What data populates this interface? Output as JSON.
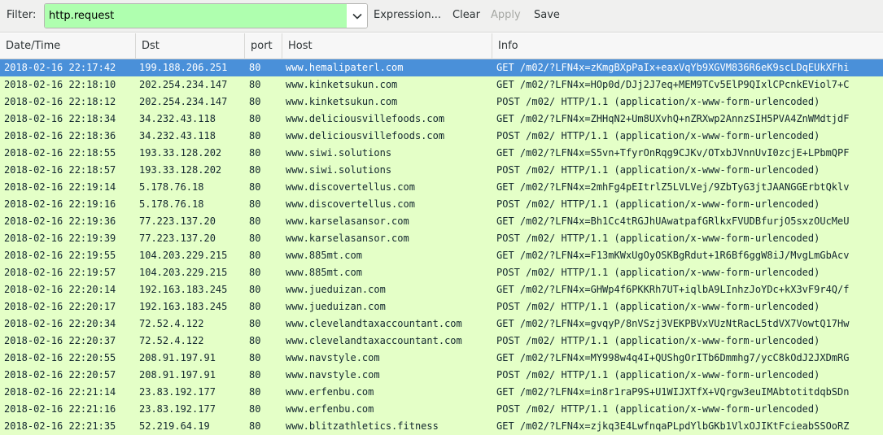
{
  "filter": {
    "label": "Filter:",
    "value": "http.request",
    "expression_label": "Expression...",
    "clear_label": "Clear",
    "apply_label": "Apply",
    "save_label": "Save"
  },
  "colors": {
    "filter_valid_bg": "#afffaf",
    "row_bg": "#e4ffc7",
    "selection": "#4a90d9"
  },
  "columns": [
    "Date/Time",
    "Dst",
    "port",
    "Host",
    "Info"
  ],
  "selected_row": 0,
  "rows": [
    {
      "time": "2018-02-16 22:17:42",
      "dst": "199.188.206.251",
      "port": "80",
      "host": "www.hemalipaterl.com",
      "info": "GET /m02/?LFN4x=zKmgBXpPaIx+eaxVqYb9XGVM836R6eK9scLDqEUkXFhi"
    },
    {
      "time": "2018-02-16 22:18:10",
      "dst": "202.254.234.147",
      "port": "80",
      "host": "www.kinketsukun.com",
      "info": "GET /m02/?LFN4x=HOp0d/DJj2J7eq+MEM9TCv5ElP9QIxlCPcnkEViol7+C"
    },
    {
      "time": "2018-02-16 22:18:12",
      "dst": "202.254.234.147",
      "port": "80",
      "host": "www.kinketsukun.com",
      "info": "POST /m02/ HTTP/1.1  (application/x-www-form-urlencoded)"
    },
    {
      "time": "2018-02-16 22:18:34",
      "dst": "34.232.43.118",
      "port": "80",
      "host": "www.deliciousvillefoods.com",
      "info": "GET /m02/?LFN4x=ZHHqN2+Um8UXvhQ+nZRXwp2AnnzSIH5PVA4ZnWMdtjdF"
    },
    {
      "time": "2018-02-16 22:18:36",
      "dst": "34.232.43.118",
      "port": "80",
      "host": "www.deliciousvillefoods.com",
      "info": "POST /m02/ HTTP/1.1  (application/x-www-form-urlencoded)"
    },
    {
      "time": "2018-02-16 22:18:55",
      "dst": "193.33.128.202",
      "port": "80",
      "host": "www.siwi.solutions",
      "info": "GET /m02/?LFN4x=S5vn+TfyrOnRqg9CJKv/OTxbJVnnUvI0zcjE+LPbmQPF"
    },
    {
      "time": "2018-02-16 22:18:57",
      "dst": "193.33.128.202",
      "port": "80",
      "host": "www.siwi.solutions",
      "info": "POST /m02/ HTTP/1.1  (application/x-www-form-urlencoded)"
    },
    {
      "time": "2018-02-16 22:19:14",
      "dst": "5.178.76.18",
      "port": "80",
      "host": "www.discovertellus.com",
      "info": "GET /m02/?LFN4x=2mhFg4pEItrlZ5LVLVej/9ZbTyG3jtJAANGGErbtQklv"
    },
    {
      "time": "2018-02-16 22:19:16",
      "dst": "5.178.76.18",
      "port": "80",
      "host": "www.discovertellus.com",
      "info": "POST /m02/ HTTP/1.1  (application/x-www-form-urlencoded)"
    },
    {
      "time": "2018-02-16 22:19:36",
      "dst": "77.223.137.20",
      "port": "80",
      "host": "www.karselasansor.com",
      "info": "GET /m02/?LFN4x=Bh1Cc4tRGJhUAwatpafGRlkxFVUDBfurjO5sxzOUcMeU"
    },
    {
      "time": "2018-02-16 22:19:39",
      "dst": "77.223.137.20",
      "port": "80",
      "host": "www.karselasansor.com",
      "info": "POST /m02/ HTTP/1.1  (application/x-www-form-urlencoded)"
    },
    {
      "time": "2018-02-16 22:19:55",
      "dst": "104.203.229.215",
      "port": "80",
      "host": "www.885mt.com",
      "info": "GET /m02/?LFN4x=F13mKWxUgOyOSKBgRdut+1R6Bf6ggW8iJ/MvgLmGbAcv"
    },
    {
      "time": "2018-02-16 22:19:57",
      "dst": "104.203.229.215",
      "port": "80",
      "host": "www.885mt.com",
      "info": "POST /m02/ HTTP/1.1  (application/x-www-form-urlencoded)"
    },
    {
      "time": "2018-02-16 22:20:14",
      "dst": "192.163.183.245",
      "port": "80",
      "host": "www.jueduizan.com",
      "info": "GET /m02/?LFN4x=GHWp4f6PKKRh7UT+iqlbA9LInhzJoYDc+kX3vF9r4Q/f"
    },
    {
      "time": "2018-02-16 22:20:17",
      "dst": "192.163.183.245",
      "port": "80",
      "host": "www.jueduizan.com",
      "info": "POST /m02/ HTTP/1.1  (application/x-www-form-urlencoded)"
    },
    {
      "time": "2018-02-16 22:20:34",
      "dst": "72.52.4.122",
      "port": "80",
      "host": "www.clevelandtaxaccountant.com",
      "info": "GET /m02/?LFN4x=gvqyP/8nVSzj3VEKPBVxVUzNtRacL5tdVX7VowtQ17Hw"
    },
    {
      "time": "2018-02-16 22:20:37",
      "dst": "72.52.4.122",
      "port": "80",
      "host": "www.clevelandtaxaccountant.com",
      "info": "POST /m02/ HTTP/1.1  (application/x-www-form-urlencoded)"
    },
    {
      "time": "2018-02-16 22:20:55",
      "dst": "208.91.197.91",
      "port": "80",
      "host": "www.navstyle.com",
      "info": "GET /m02/?LFN4x=MY998w4q4I+QUShgOrITb6Dmmhg7/ycC8kOdJ2JXDmRG"
    },
    {
      "time": "2018-02-16 22:20:57",
      "dst": "208.91.197.91",
      "port": "80",
      "host": "www.navstyle.com",
      "info": "POST /m02/ HTTP/1.1  (application/x-www-form-urlencoded)"
    },
    {
      "time": "2018-02-16 22:21:14",
      "dst": "23.83.192.177",
      "port": "80",
      "host": "www.erfenbu.com",
      "info": "GET /m02/?LFN4x=in8r1raP9S+U1WIJXTfX+VQrgw3euIMAbtotitdqbSDn"
    },
    {
      "time": "2018-02-16 22:21:16",
      "dst": "23.83.192.177",
      "port": "80",
      "host": "www.erfenbu.com",
      "info": "POST /m02/ HTTP/1.1  (application/x-www-form-urlencoded)"
    },
    {
      "time": "2018-02-16 22:21:35",
      "dst": "52.219.64.19",
      "port": "80",
      "host": "www.blitzathletics.fitness",
      "info": "GET /m02/?LFN4x=zjkq3E4LwfnqaPLpdYlbGKb1VlxOJIKtFcieabSSOoRZ"
    }
  ]
}
